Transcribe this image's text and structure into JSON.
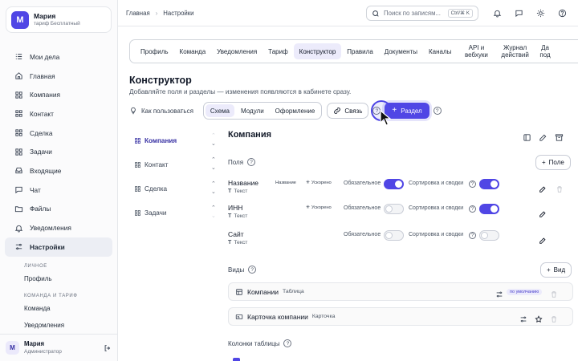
{
  "user": {
    "initial": "М",
    "name": "Мария",
    "plan": "тариф Бесплатный",
    "role": "Администратор"
  },
  "sidebar": {
    "items": [
      {
        "label": "Мои дела",
        "icon": "checklist-icon"
      },
      {
        "label": "Главная",
        "icon": "home-icon"
      },
      {
        "label": "Компания",
        "icon": "grid-icon"
      },
      {
        "label": "Контакт",
        "icon": "grid-icon"
      },
      {
        "label": "Сделка",
        "icon": "grid-icon"
      },
      {
        "label": "Задачи",
        "icon": "grid-icon"
      },
      {
        "label": "Входящие",
        "icon": "inbox-icon"
      },
      {
        "label": "Чат",
        "icon": "chat-icon"
      },
      {
        "label": "Файлы",
        "icon": "folder-icon"
      },
      {
        "label": "Уведомления",
        "icon": "bell-icon"
      },
      {
        "label": "Настройки",
        "icon": "sliders-icon",
        "active": true
      }
    ],
    "section_personal": "ЛИЧНОЕ",
    "profile": "Профиль",
    "section_team": "КОМАНДА И ТАРИФ",
    "team": "Команда",
    "notifications": "Уведомления"
  },
  "breadcrumb": {
    "home": "Главная",
    "sep": "›",
    "current": "Настройки"
  },
  "search": {
    "placeholder": "Поиск по записям...",
    "shortcut": "Ctrl/⌘ K"
  },
  "tabs": [
    "Профиль",
    "Команда",
    "Уведомления",
    "Тариф",
    "Конструктор",
    "Правила",
    "Документы",
    "Каналы",
    "API и вебхуки",
    "Журнал действий",
    "Да под"
  ],
  "active_tab": "Конструктор",
  "page": {
    "title": "Конструктор",
    "subtitle": "Добавляйте поля и разделы — изменения появляются в кабинете сразу."
  },
  "toolbar": {
    "howto": "Как пользоваться",
    "segments": [
      "Схема",
      "Модули",
      "Оформление"
    ],
    "active_segment": "Схема",
    "link_label": "Связь",
    "add_section_label": "Раздел"
  },
  "sections": [
    "Компания",
    "Контакт",
    "Сделка",
    "Задачи"
  ],
  "active_section": "Компания",
  "panel": {
    "title": "Компания",
    "fields_label": "Поля",
    "add_field_label": "Поле",
    "fields": [
      {
        "name": "Название",
        "type": "Текст",
        "chip": "Название",
        "fast": "Ускорено",
        "required": true,
        "sorting": true
      },
      {
        "name": "ИНН",
        "type": "Текст",
        "chip": "",
        "fast": "Ускорено",
        "required": false,
        "sorting": true
      },
      {
        "name": "Сайт",
        "type": "Текст",
        "chip": "",
        "fast": "",
        "required": false,
        "sorting": false
      }
    ],
    "required_label": "Обязательное",
    "sorting_label": "Сортировка и сводки",
    "views_label": "Виды",
    "add_view_label": "Вид",
    "views": [
      {
        "name": "Компании",
        "type": "Таблица",
        "badge": "по умолчанию"
      },
      {
        "name": "Карточка компании",
        "type": "Карточка",
        "badge": ""
      }
    ],
    "columns_label": "Колонки таблицы"
  }
}
